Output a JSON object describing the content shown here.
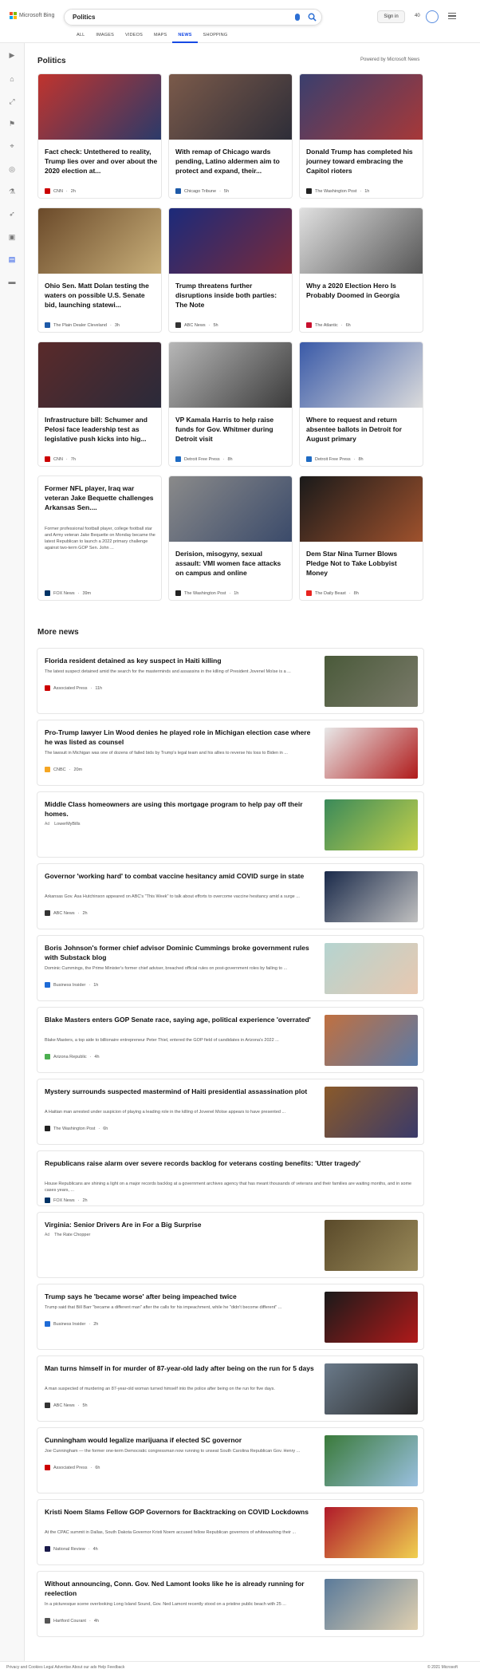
{
  "header": {
    "logo": "Microsoft Bing",
    "search_query": "Politics",
    "tabs": [
      "ALL",
      "IMAGES",
      "VIDEOS",
      "MAPS",
      "NEWS",
      "SHOPPING"
    ],
    "active_tab": "NEWS",
    "sign_in": "Sign in",
    "points": "40",
    "colors": {
      "accent": "#174ae4",
      "ms_red": "#f25022",
      "ms_green": "#7fba00",
      "ms_blue": "#00a4ef",
      "ms_yellow": "#ffb900"
    }
  },
  "sidebar_icons": [
    "chevron-right-icon",
    "home-icon",
    "expand-icon",
    "flag-icon",
    "location-icon",
    "globe-icon",
    "science-icon",
    "rocket-icon",
    "entertainment-icon",
    "politics-icon",
    "money-icon"
  ],
  "main": {
    "title": "Politics",
    "powered_by": "Powered by Microsoft News",
    "cards": [
      {
        "title": "Fact check: Untethered to reality, Trump lies over and over about the 2020 election at...",
        "source": "CNN",
        "time": "2h",
        "badge_color": "#cc0000",
        "img_colors": [
          "#c0342e",
          "#2a3a6a"
        ]
      },
      {
        "title": "With remap of Chicago wards pending, Latino aldermen aim to protect and expand, their...",
        "source": "Chicago Tribune",
        "time": "5h",
        "badge_color": "#1e5aa8",
        "img_colors": [
          "#7b5a4a",
          "#2d2d38"
        ]
      },
      {
        "title": "Donald Trump has completed his journey toward embracing the Capitol rioters",
        "source": "The Washington Post",
        "time": "1h",
        "badge_color": "#222222",
        "img_colors": [
          "#3a3f6e",
          "#a83838"
        ]
      },
      {
        "title": "Ohio Sen. Matt Dolan testing the waters on possible U.S. Senate bid, launching statewi...",
        "source": "The Plain Dealer Cleveland",
        "time": "3h",
        "badge_color": "#1e5aa8",
        "img_colors": [
          "#6b4a2a",
          "#c9b07a"
        ]
      },
      {
        "title": "Trump threatens further disruptions inside both parties: The Note",
        "source": "ABC News",
        "time": "5h",
        "badge_color": "#333333",
        "img_colors": [
          "#1c2a7a",
          "#7a2a3a"
        ]
      },
      {
        "title": "Why a 2020 Election Hero Is Probably Doomed in Georgia",
        "source": "The Atlantic",
        "time": "6h",
        "badge_color": "#c8102e",
        "img_colors": [
          "#e0e0e0",
          "#555555"
        ]
      },
      {
        "title": "Infrastructure bill: Schumer and Pelosi face leadership test as legislative push kicks into hig...",
        "source": "CNN",
        "time": "7h",
        "badge_color": "#cc0000",
        "img_colors": [
          "#5a2a2a",
          "#2a2a3a"
        ]
      },
      {
        "title": "VP Kamala Harris to help raise funds for Gov. Whitmer during Detroit visit",
        "source": "Detroit Free Press",
        "time": "8h",
        "badge_color": "#1e6bc4",
        "img_colors": [
          "#b7b7b7",
          "#3a3a3a"
        ]
      },
      {
        "title": "Where to request and return absentee ballots in Detroit for August primary",
        "source": "Detroit Free Press",
        "time": "8h",
        "badge_color": "#1e6bc4",
        "img_colors": [
          "#3a5aa8",
          "#dcdcdc"
        ]
      },
      {
        "title": "Former NFL player, Iraq war veteran Jake Bequette challenges Arkansas Sen....",
        "summary": "Former professional football player, college football star and Army veteran Jake Bequette on Monday became the latest Republican to launch a 2022 primary challenge against two-term GOP Sen. John ...",
        "source": "FOX News",
        "time": "39m",
        "badge_color": "#003366"
      },
      {
        "title": "Derision, misogyny, sexual assault: VMI women face attacks on campus and online",
        "source": "The Washington Post",
        "time": "1h",
        "badge_color": "#222222",
        "img_colors": [
          "#8a8a8a",
          "#3a4a6a"
        ]
      },
      {
        "title": "Dem Star Nina Turner Blows Pledge Not to Take Lobbyist Money",
        "source": "The Daily Beast",
        "time": "8h",
        "badge_color": "#e8231f",
        "img_colors": [
          "#1a1a1a",
          "#a0522d"
        ]
      }
    ]
  },
  "more_news": {
    "title": "More news",
    "items": [
      {
        "title": "Florida resident detained as key suspect in Haiti killing",
        "summary": "The latest suspect detained amid the search for the masterminds and assassins in the killing of President Jovenel Moïse is a ...",
        "source": "Associated Press",
        "time": "11h",
        "badge_color": "#cc0000",
        "img_colors": [
          "#4a5a3a",
          "#7a7a6a"
        ]
      },
      {
        "title": "Pro-Trump lawyer Lin Wood denies he played role in Michigan election case where he was listed as counsel",
        "summary": "The lawsuit in Michigan was one of dozens of failed bids by Trump's legal team and his allies to reverse his loss to Biden in ...",
        "source": "CNBC",
        "time": "20m",
        "badge_color": "#f5a623",
        "img_colors": [
          "#e8e8e8",
          "#b01a1a"
        ]
      },
      {
        "title": "Middle Class homeowners are using this mortgage program to help pay off their homes.",
        "ad_label": "Ad",
        "source": "LowerMyBills",
        "time": "",
        "img_colors": [
          "#3a8a5a",
          "#c4d04a"
        ]
      },
      {
        "title": "Governor 'working hard' to combat vaccine hesitancy amid COVID surge in state",
        "summary": "Arkansas Gov. Asa Hutchinson appeared on ABC's \"This Week\" to talk about efforts to overcome vaccine hesitancy amid a surge ...",
        "source": "ABC News",
        "time": "2h",
        "badge_color": "#333333",
        "img_colors": [
          "#1a2a4a",
          "#c0c0c0"
        ]
      },
      {
        "title": "Boris Johnson's former chief advisor Dominic Cummings broke government rules with Substack blog",
        "summary": "Dominic Cummings, the Prime Minister's former chief adviser, breached official rules on post-government roles by failing to ...",
        "source": "Business Insider",
        "time": "1h",
        "badge_color": "#1e6bd6",
        "img_colors": [
          "#b5d4d0",
          "#e8c8b0"
        ]
      },
      {
        "title": "Blake Masters enters GOP Senate race, saying age, political experience 'overrated'",
        "summary": "Blake Masters, a top aide to billionaire entrepreneur Peter Thiel, entered the GOP field of candidates in Arizona's 2022 ...",
        "source": "Arizona Republic",
        "time": "4h",
        "badge_color": "#4caf50",
        "img_colors": [
          "#c07040",
          "#5a7aa8"
        ]
      },
      {
        "title": "Mystery surrounds suspected mastermind of Haiti presidential assassination plot",
        "summary": "A Haitian man arrested under suspicion of playing a leading role in the killing of Jovenel Moïse appears to have presented ...",
        "source": "The Washington Post",
        "time": "6h",
        "badge_color": "#222222",
        "img_colors": [
          "#8a5a2a",
          "#3a3a6a"
        ]
      },
      {
        "title": "Republicans raise alarm over severe records backlog for veterans costing benefits: 'Utter tragedy'",
        "summary": "House Republicans are shining a light on a major records backlog at a government archives agency that has meant thousands of veterans and their families are waiting months, and in some cases years, ...",
        "source": "FOX News",
        "time": "2h",
        "badge_color": "#003366"
      },
      {
        "title": "Virginia: Senior Drivers Are in For a Big Surprise",
        "ad_label": "Ad",
        "source": "The Rate Chopper",
        "time": "",
        "img_colors": [
          "#5a4a2a",
          "#9a8a5a"
        ]
      },
      {
        "title": "Trump says he 'became worse' after being impeached twice",
        "summary": "Trump said that Bill Barr \"became a different man\" after the calls for his impeachment, while he \"didn't become different\" ...",
        "source": "Business Insider",
        "time": "2h",
        "badge_color": "#1e6bd6",
        "img_colors": [
          "#1a1a1a",
          "#b01a1a"
        ]
      },
      {
        "title": "Man turns himself in for murder of 87-year-old lady after being on the run for 5 days",
        "summary": "A man suspected of murdering an 87-year-old woman turned himself into the police after being on the run for five days.",
        "source": "ABC News",
        "time": "5h",
        "badge_color": "#333333",
        "img_colors": [
          "#6a7a8a",
          "#2a2a2a"
        ]
      },
      {
        "title": "Cunningham would legalize marijuana if elected SC governor",
        "summary": "Joe Cunningham — the former one-term Democratic congressman now running to unseat South Carolina Republican Gov. Henry ...",
        "source": "Associated Press",
        "time": "6h",
        "badge_color": "#cc0000",
        "img_colors": [
          "#3a7a3a",
          "#9ac0e0"
        ]
      },
      {
        "title": "Kristi Noem Slams Fellow GOP Governors for Backtracking on COVID Lockdowns",
        "summary": "At the CPAC summit in Dallas, South Dakota Governor Kristi Noem accused fellow Republican governors of whitewashing their ...",
        "source": "National Review",
        "time": "4h",
        "badge_color": "#1a1a4a",
        "img_colors": [
          "#b01a2a",
          "#f0d050"
        ]
      },
      {
        "title": "Without announcing, Conn. Gov. Ned Lamont looks like he is already running for reelection",
        "summary": "In a picturesque scene overlooking Long Island Sound, Gov. Ned Lamont recently stood on a pristine public beach with 25 ...",
        "source": "Hartford Courant",
        "time": "4h",
        "badge_color": "#555555",
        "img_colors": [
          "#5a7a9a",
          "#e0d0b0"
        ]
      }
    ]
  },
  "footer": {
    "left": "Privacy and Cookies   Legal   Advertise   About our ads   Help   Feedback",
    "right": "© 2021 Microsoft"
  }
}
